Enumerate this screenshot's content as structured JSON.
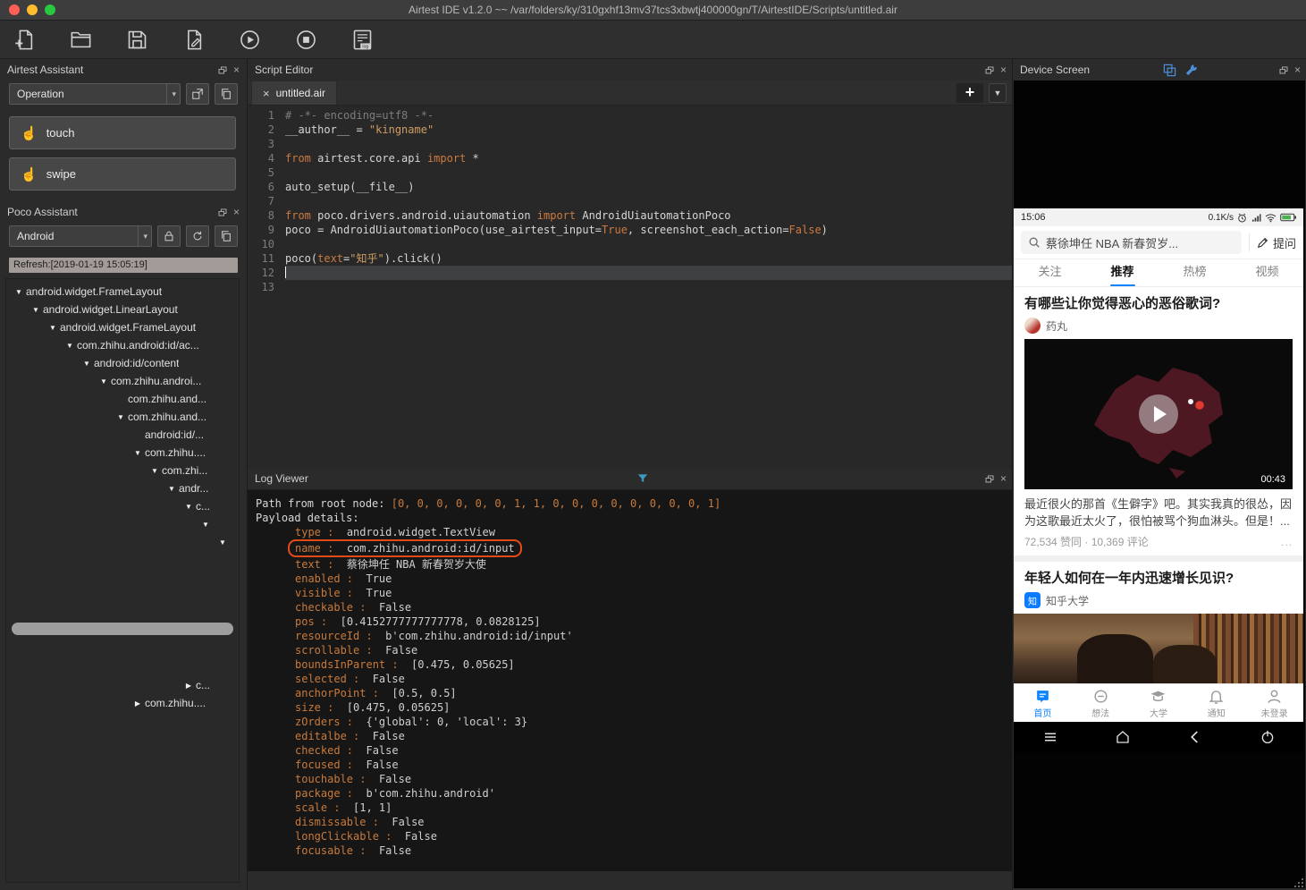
{
  "window": {
    "title": "Airtest IDE v1.2.0 ~~ /var/folders/ky/310gxhf13mv37tcs3xbwtj400000gn/T/AirtestIDE/Scripts/untitled.air"
  },
  "airtest_assistant": {
    "title": "Airtest Assistant",
    "mode": "Operation",
    "touch_label": "touch",
    "swipe_label": "swipe"
  },
  "poco_assistant": {
    "title": "Poco Assistant",
    "platform": "Android",
    "refresh_label": "Refresh:[2019-01-19 15:05:19]",
    "tree": [
      {
        "depth": 0,
        "arrow": "open",
        "label": "android.widget.FrameLayout"
      },
      {
        "depth": 1,
        "arrow": "open",
        "label": "android.widget.LinearLayout"
      },
      {
        "depth": 2,
        "arrow": "open",
        "label": "android.widget.FrameLayout"
      },
      {
        "depth": 3,
        "arrow": "open",
        "label": "com.zhihu.android:id/ac..."
      },
      {
        "depth": 4,
        "arrow": "open",
        "label": "android:id/content"
      },
      {
        "depth": 5,
        "arrow": "open",
        "label": "com.zhihu.androi..."
      },
      {
        "depth": 6,
        "arrow": "none",
        "label": "com.zhihu.and..."
      },
      {
        "depth": 6,
        "arrow": "open",
        "label": "com.zhihu.and..."
      },
      {
        "depth": 7,
        "arrow": "none",
        "label": "android:id/..."
      },
      {
        "depth": 7,
        "arrow": "open",
        "label": "com.zhihu...."
      },
      {
        "depth": 8,
        "arrow": "open",
        "label": "com.zhi..."
      },
      {
        "depth": 9,
        "arrow": "open",
        "label": "andr..."
      },
      {
        "depth": 10,
        "arrow": "open",
        "label": "c..."
      },
      {
        "depth": 11,
        "arrow": "open",
        "label": ""
      },
      {
        "depth": 12,
        "arrow": "open",
        "label": ""
      }
    ],
    "tree_bottom": [
      {
        "depth": 10,
        "arrow": "closed",
        "label": "c..."
      },
      {
        "depth": 7,
        "arrow": "closed",
        "label": "com.zhihu...."
      }
    ]
  },
  "script_editor": {
    "title": "Script Editor",
    "tab": "untitled.air",
    "code": [
      {
        "n": 1,
        "seg": [
          [
            "c",
            "# -*- encoding=utf8 -*-"
          ]
        ]
      },
      {
        "n": 2,
        "seg": [
          [
            "p",
            "__author__ = "
          ],
          [
            "s",
            "\"kingname\""
          ]
        ]
      },
      {
        "n": 3,
        "seg": []
      },
      {
        "n": 4,
        "seg": [
          [
            "k",
            "from"
          ],
          [
            "p",
            " airtest.core.api "
          ],
          [
            "k",
            "import"
          ],
          [
            "p",
            " *"
          ]
        ]
      },
      {
        "n": 5,
        "seg": []
      },
      {
        "n": 6,
        "seg": [
          [
            "p",
            "auto_setup(__file__)"
          ]
        ]
      },
      {
        "n": 7,
        "seg": []
      },
      {
        "n": 8,
        "seg": [
          [
            "k",
            "from"
          ],
          [
            "p",
            " poco.drivers.android.uiautomation "
          ],
          [
            "k",
            "import"
          ],
          [
            "p",
            " AndroidUiautomationPoco"
          ]
        ]
      },
      {
        "n": 9,
        "seg": [
          [
            "p",
            "poco = AndroidUiautomationPoco(use_airtest_input="
          ],
          [
            "k",
            "True"
          ],
          [
            "p",
            ", screenshot_each_action="
          ],
          [
            "k",
            "False"
          ],
          [
            "p",
            ")"
          ]
        ]
      },
      {
        "n": 10,
        "seg": []
      },
      {
        "n": 11,
        "seg": [
          [
            "p",
            "poco("
          ],
          [
            "k",
            "text"
          ],
          [
            "p",
            "="
          ],
          [
            "s",
            "\"知乎\""
          ],
          [
            "p",
            ").click()"
          ]
        ]
      },
      {
        "n": 12,
        "seg": [],
        "current": true
      },
      {
        "n": 13,
        "seg": []
      }
    ]
  },
  "log_viewer": {
    "title": "Log Viewer",
    "intro": [
      {
        "plain": "Path from root node: ",
        "accent": "[0, 0, 0, 0, 0, 0, 1, 1, 0, 0, 0, 0, 0, 0, 0, 0, 1]"
      },
      {
        "plain": "Payload details:",
        "accent": ""
      }
    ],
    "fields": [
      {
        "key": "type",
        "value": "android.widget.TextView"
      },
      {
        "key": "name",
        "value": "com.zhihu.android:id/input",
        "highlighted": true
      },
      {
        "key": "text",
        "value": "蔡徐坤任 NBA 新春贺岁大使"
      },
      {
        "key": "enabled",
        "value": "True"
      },
      {
        "key": "visible",
        "value": "True"
      },
      {
        "key": "checkable",
        "value": "False"
      },
      {
        "key": "pos",
        "value": "[0.4152777777777778, 0.0828125]"
      },
      {
        "key": "resourceId",
        "value": "b'com.zhihu.android:id/input'"
      },
      {
        "key": "scrollable",
        "value": "False"
      },
      {
        "key": "boundsInParent",
        "value": "[0.475, 0.05625]"
      },
      {
        "key": "selected",
        "value": "False"
      },
      {
        "key": "anchorPoint",
        "value": "[0.5, 0.5]"
      },
      {
        "key": "size",
        "value": "[0.475, 0.05625]"
      },
      {
        "key": "zOrders",
        "value": "{'global': 0, 'local': 3}"
      },
      {
        "key": "editalbe",
        "value": "False"
      },
      {
        "key": "checked",
        "value": "False"
      },
      {
        "key": "focused",
        "value": "False"
      },
      {
        "key": "touchable",
        "value": "False"
      },
      {
        "key": "package",
        "value": "b'com.zhihu.android'"
      },
      {
        "key": "scale",
        "value": "[1, 1]"
      },
      {
        "key": "dismissable",
        "value": "False"
      },
      {
        "key": "longClickable",
        "value": "False"
      },
      {
        "key": "focusable",
        "value": "False"
      }
    ]
  },
  "device_screen": {
    "title": "Device Screen",
    "status": {
      "time": "15:06",
      "net_speed": "0.1K/s"
    },
    "search": {
      "query": "蔡徐坤任 NBA 新春贺岁...",
      "ask": "提问"
    },
    "tabs": [
      {
        "label": "关注",
        "active": false
      },
      {
        "label": "推荐",
        "active": true
      },
      {
        "label": "热榜",
        "active": false
      },
      {
        "label": "视频",
        "active": false
      }
    ],
    "card1": {
      "title": "有哪些让你觉得恶心的恶俗歌词?",
      "author": "药丸",
      "duration": "00:43",
      "excerpt": "最近很火的那首《生僻字》吧。其实我真的很怂，因为这歌最近太火了，很怕被骂个狗血淋头。但是！...",
      "stats": "72,534 赞同 · 10,369 评论",
      "more": "..."
    },
    "card2": {
      "title": "年轻人如何在一年内迅速增长见识?",
      "author": "知乎大学",
      "avatar_letter": "知"
    },
    "bottom_nav": [
      {
        "label": "首页",
        "active": true
      },
      {
        "label": "想法",
        "active": false
      },
      {
        "label": "大学",
        "active": false
      },
      {
        "label": "通知",
        "active": false
      },
      {
        "label": "未登录",
        "active": false
      }
    ]
  }
}
